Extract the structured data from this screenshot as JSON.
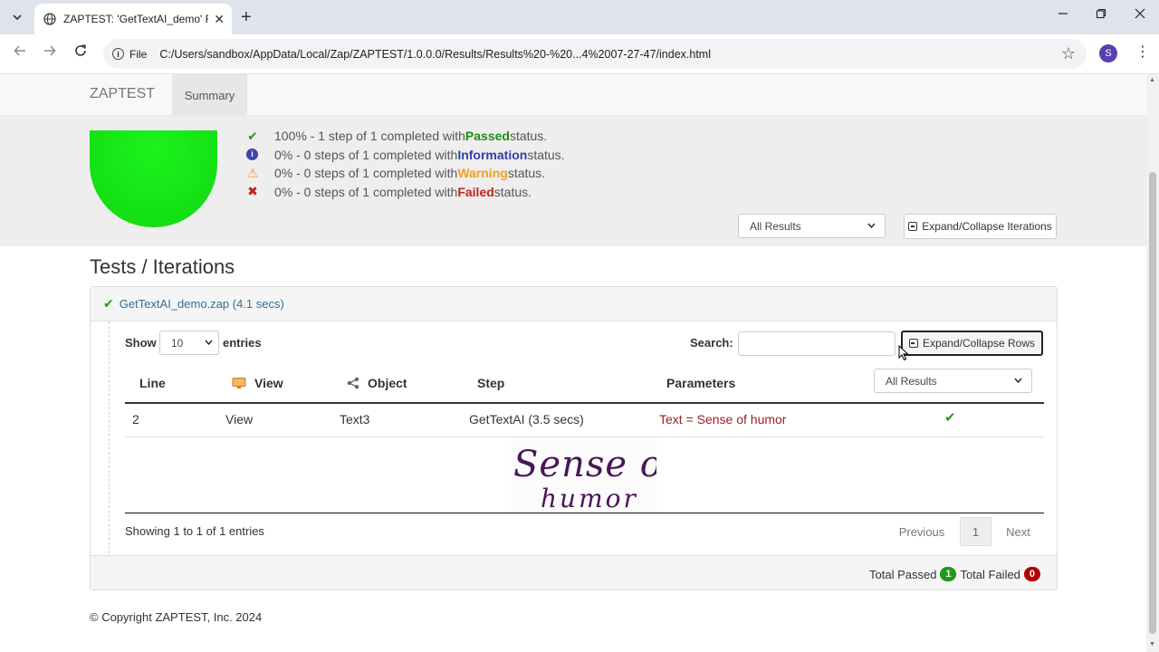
{
  "browser": {
    "tab_title": "ZAPTEST: 'GetTextAI_demo' Ru",
    "new_tab": "+",
    "site_info": "File",
    "url": "C:/Users/sandbox/AppData/Local/Zap/ZAPTEST/1.0.0.0/Results/Results%20-%20...4%2007-27-47/index.html",
    "profile_initial": "S"
  },
  "navbar": {
    "brand": "ZAPTEST",
    "summary_tab": "Summary"
  },
  "summary": {
    "pass_rate": 1.0,
    "rows": [
      {
        "prefix": "100% - 1 step of 1 completed with ",
        "keyword": "Passed",
        "suffix": " status."
      },
      {
        "prefix": "0% - 0 steps of 1 completed with ",
        "keyword": "Information",
        "suffix": " status."
      },
      {
        "prefix": "0% - 0 steps of 1 completed with ",
        "keyword": "Warning",
        "suffix": " status."
      },
      {
        "prefix": "0% - 0 steps of 1 completed with ",
        "keyword": "Failed",
        "suffix": " status."
      }
    ],
    "filter_select": "All Results",
    "expand_iterations_label": "Expand/Collapse Iterations"
  },
  "tests": {
    "section_title": "Tests / Iterations",
    "test_name": "GetTextAI_demo.zap (4.1 secs)",
    "show_label": "Show",
    "entries_value": "10",
    "entries_label": "entries",
    "search_label": "Search:",
    "search_value": "",
    "expand_rows_label": "Expand/Collapse Rows",
    "row_filter_select": "All Results",
    "columns": {
      "line": "Line",
      "view": "View",
      "object": "Object",
      "step": "Step",
      "parameters": "Parameters"
    },
    "rows": [
      {
        "line": "2",
        "view": "View",
        "object": "Text3",
        "step": "GetTextAI (3.5 secs)",
        "parameters": "Text = Sense of humor",
        "status": "passed"
      }
    ],
    "capture_text_line1": "Sense of",
    "capture_text_line2": "humor",
    "info": "Showing 1 to 1 of 1 entries",
    "pager": {
      "previous": "Previous",
      "current": "1",
      "next": "Next"
    },
    "totals": {
      "passed_label": "Total Passed",
      "passed_count": "1",
      "failed_label": "Total Failed",
      "failed_count": "0"
    }
  },
  "footer": {
    "copyright": "© Copyright ZAPTEST, Inc. 2024"
  },
  "colors": {
    "passed": "#1c8d13",
    "information": "#323fa6",
    "warning": "#f0a020",
    "failed": "#c0221f",
    "parameter_text": "#9a1f2f"
  }
}
